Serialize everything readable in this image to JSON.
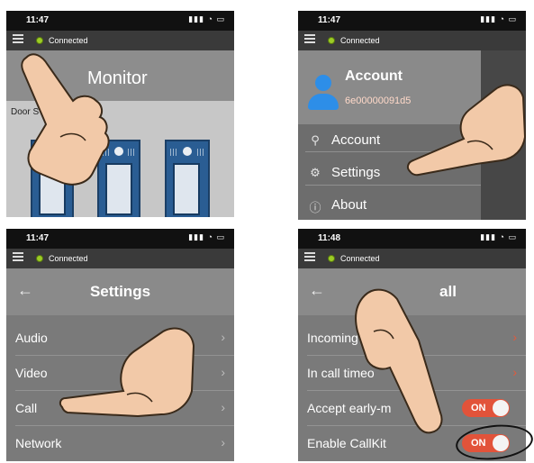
{
  "panels": [
    {
      "status": {
        "time": "11:47",
        "icons": "signal-wifi-battery"
      },
      "connection": {
        "label": "Connected",
        "color": "#9ccc25"
      },
      "title": "Monitor",
      "section_label": "Door S"
    },
    {
      "status": {
        "time": "11:47",
        "icons": "signal-wifi-battery"
      },
      "connection": {
        "label": "Connected"
      },
      "account": {
        "name": "Account",
        "id": "6e00000091d5"
      },
      "menu": [
        {
          "label": "Account",
          "icon": "person-icon"
        },
        {
          "label": "Settings",
          "icon": "gear-icon"
        },
        {
          "label": "About",
          "icon": "info-icon"
        }
      ]
    },
    {
      "status": {
        "time": "11:47",
        "icons": "signal-wifi-battery"
      },
      "connection": {
        "label": "Connected"
      },
      "title": "Settings",
      "rows": [
        "Audio",
        "Video",
        "Call",
        "Network"
      ]
    },
    {
      "status": {
        "time": "11:48",
        "icons": "signal-wifi-battery"
      },
      "connection": {
        "label": "Connected"
      },
      "title": "all",
      "rows": [
        {
          "label": "Incoming"
        },
        {
          "label": "In call timeo"
        },
        {
          "label": "Accept early-m",
          "toggle": "ON"
        },
        {
          "label": "Enable CallKit",
          "toggle": "ON"
        }
      ]
    }
  ],
  "colors": {
    "accent": "#e2533a",
    "connected": "#9ccc25",
    "avatar": "#2d8ee8"
  }
}
